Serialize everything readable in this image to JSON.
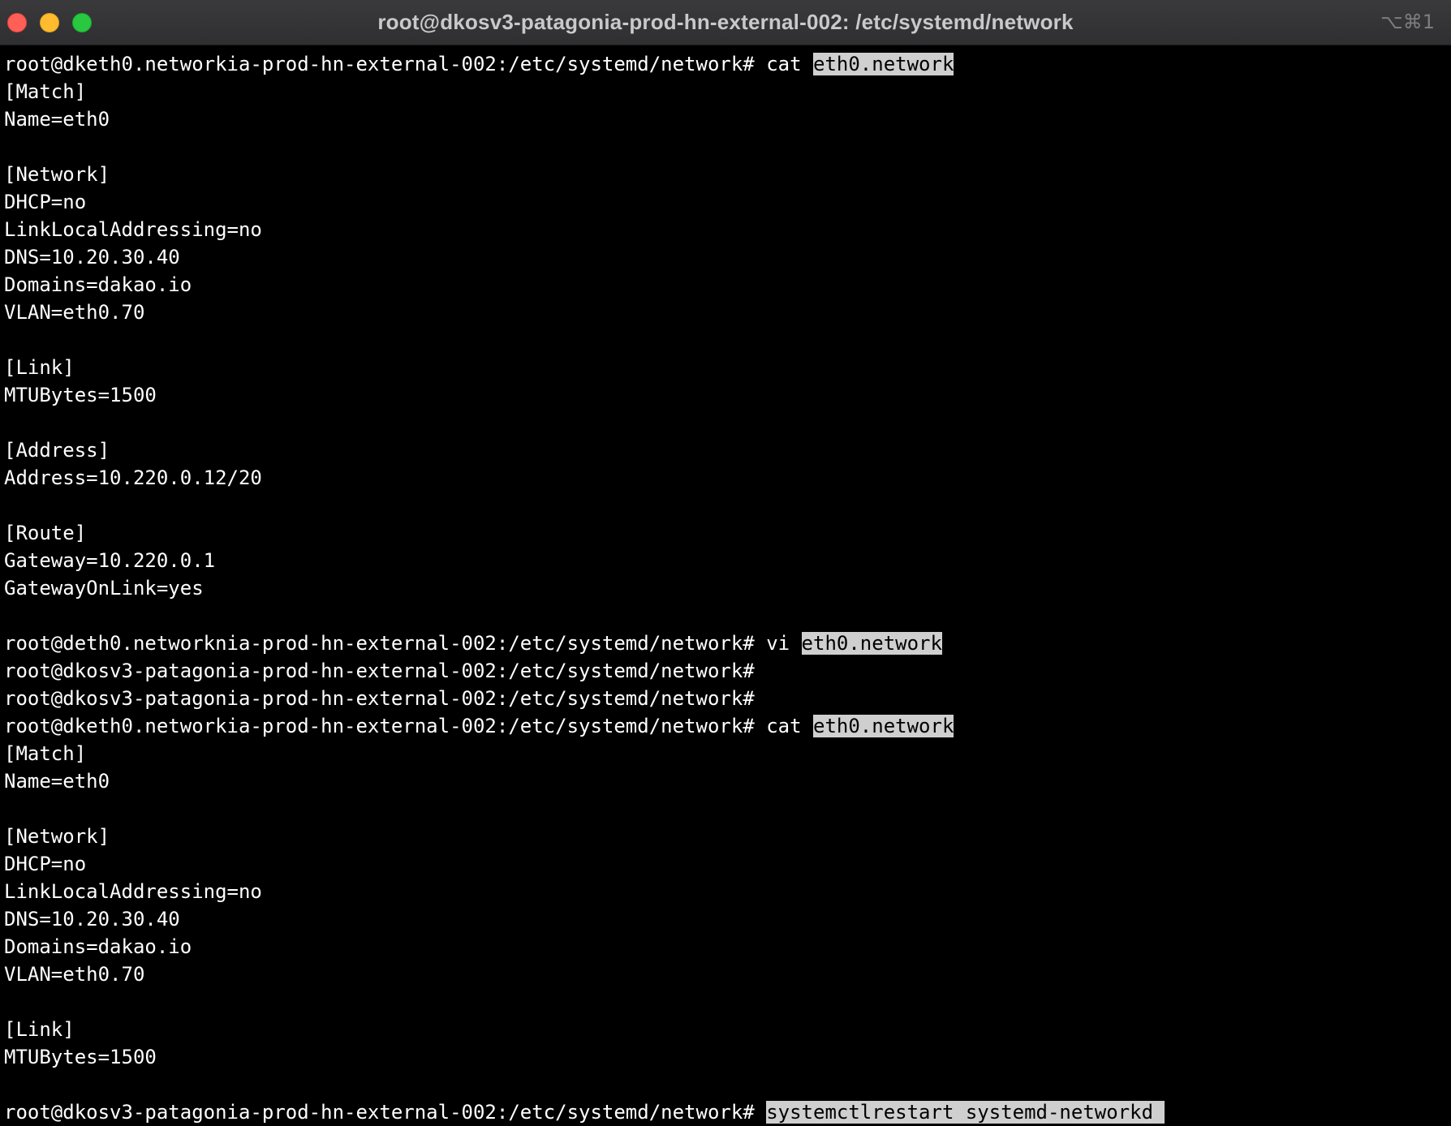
{
  "window": {
    "title": "root@dkosv3-patagonia-prod-hn-external-002: /etc/systemd/network",
    "shortcut": "⌥⌘1"
  },
  "terminal": {
    "lines": [
      {
        "prompt": "root@dketh0.networkia-prod-hn-external-002:/etc/systemd/network#",
        "cmd": " cat ",
        "hl": "eth0.network"
      },
      {
        "text": "[Match]"
      },
      {
        "text": "Name=eth0"
      },
      {
        "text": ""
      },
      {
        "text": "[Network]"
      },
      {
        "text": "DHCP=no"
      },
      {
        "text": "LinkLocalAddressing=no"
      },
      {
        "text": "DNS=10.20.30.40"
      },
      {
        "text": "Domains=dakao.io"
      },
      {
        "text": "VLAN=eth0.70"
      },
      {
        "text": ""
      },
      {
        "text": "[Link]"
      },
      {
        "text": "MTUBytes=1500"
      },
      {
        "text": ""
      },
      {
        "text": "[Address]"
      },
      {
        "text": "Address=10.220.0.12/20"
      },
      {
        "text": ""
      },
      {
        "text": "[Route]"
      },
      {
        "text": "Gateway=10.220.0.1"
      },
      {
        "text": "GatewayOnLink=yes"
      },
      {
        "text": ""
      },
      {
        "prompt": "root@deth0.networknia-prod-hn-external-002:/etc/systemd/network#",
        "cmd": " vi ",
        "hl": "eth0.network"
      },
      {
        "prompt": "root@dkosv3-patagonia-prod-hn-external-002:/etc/systemd/network#",
        "cmd": "",
        "hl": ""
      },
      {
        "prompt": "root@dkosv3-patagonia-prod-hn-external-002:/etc/systemd/network#",
        "cmd": "",
        "hl": ""
      },
      {
        "prompt": "root@dketh0.networkia-prod-hn-external-002:/etc/systemd/network#",
        "cmd": " cat ",
        "hl": "eth0.network"
      },
      {
        "text": "[Match]"
      },
      {
        "text": "Name=eth0"
      },
      {
        "text": ""
      },
      {
        "text": "[Network]"
      },
      {
        "text": "DHCP=no"
      },
      {
        "text": "LinkLocalAddressing=no"
      },
      {
        "text": "DNS=10.20.30.40"
      },
      {
        "text": "Domains=dakao.io"
      },
      {
        "text": "VLAN=eth0.70"
      },
      {
        "text": ""
      },
      {
        "text": "[Link]"
      },
      {
        "text": "MTUBytes=1500"
      },
      {
        "text": ""
      },
      {
        "prompt": "root@dkosv3-patagonia-prod-hn-external-002:/etc/systemd/network#",
        "cmd": " ",
        "hl": "systemctlrestart systemd-networkd "
      }
    ]
  }
}
